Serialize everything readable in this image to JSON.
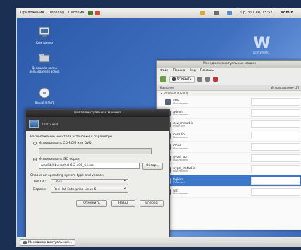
{
  "topbar": {
    "menu": [
      "Приложения",
      "Переход",
      "Система"
    ],
    "clock": "Ср, 30 Сен, 15:57",
    "user": "admin"
  },
  "desktop": {
    "icons": [
      {
        "label": "Компьютер",
        "icon": "computer-icon"
      },
      {
        "label": "Домашняя папка пользователя admin",
        "icon": "home-folder-icon"
      },
      {
        "label": "Rhel 6.0 DVD",
        "icon": "dvd-icon"
      }
    ],
    "logo_text": "JustWork"
  },
  "vmm": {
    "title": "Менеджер виртуальных машин",
    "menu": [
      "Файл",
      "Правка",
      "Вид",
      "Помощь"
    ],
    "toolbar": {
      "open": "Открыть"
    },
    "columns": {
      "name": "Название",
      "cpu": "Использование ЦП"
    },
    "host": "localhost (QEMU)",
    "vms": [
      {
        "name": "r6lb",
        "status": "Выключена"
      },
      {
        "name": "admin",
        "status": "Выключена"
      },
      {
        "name": "cow_meturbin",
        "status": "Работает"
      },
      {
        "name": "cona lib",
        "status": "Выключена"
      },
      {
        "name": "cloud",
        "status": "Выключена"
      },
      {
        "name": "sygel_lab",
        "status": "Выключена"
      },
      {
        "name": "sygel_metasbin",
        "status": "Выключена"
      },
      {
        "name": "hqborn",
        "status": "Работает"
      },
      {
        "name": "vist",
        "status": "Выключена"
      }
    ]
  },
  "dialog": {
    "title": "Новая виртуальная машина",
    "step": "Шаг 2 из 4",
    "install_media_label": "Расположение носителя установки и параметры",
    "option_cdrom": "Использовать CD-ROM или DVD",
    "option_iso": "Использовать ISO образ:",
    "iso_path": "/var/lib/libvirt/rhel-6.2-x86_64.iso",
    "browse_label": "Обзор...",
    "os_section": "Choose an operating system type and version",
    "os_type_label": "Тип ОС:",
    "os_type_value": "Linux",
    "version_label": "Версия:",
    "version_value": "Red Hat Enterprise Linux 6",
    "cancel_label": "Отменить",
    "back_label": "Назад",
    "forward_label": "Вперёд"
  },
  "taskbar": {
    "task_label": "Менеджер виртуальных..."
  },
  "colors": {
    "desktop_blue": "#3f6fbf",
    "selection_blue": "#3d78c8",
    "dialog_header": "#3b3b3b"
  }
}
